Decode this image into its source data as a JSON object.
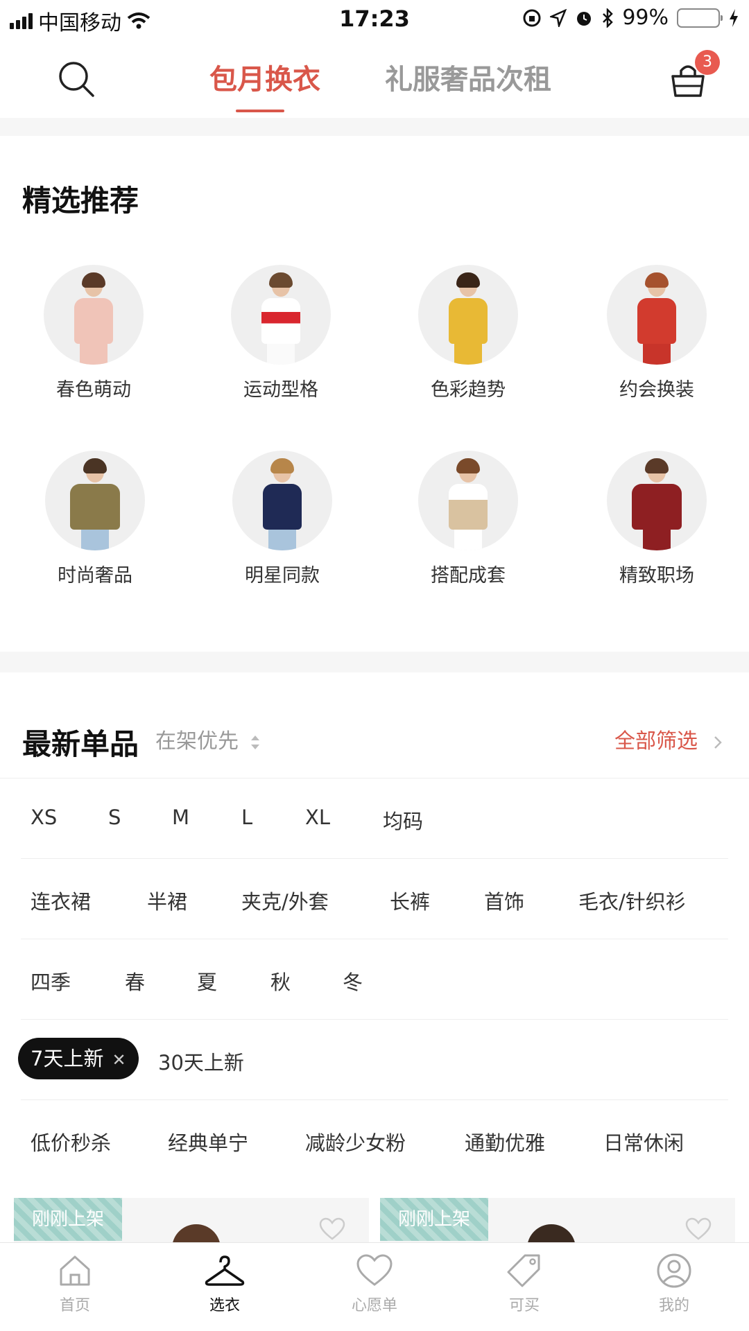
{
  "status": {
    "carrier": "中国移动",
    "time": "17:23",
    "battery": "99%"
  },
  "header": {
    "tabs": [
      {
        "label": "包月换衣"
      },
      {
        "label": "礼服奢品次租"
      }
    ],
    "cart_count": "3"
  },
  "featured": {
    "title": "精选推荐",
    "categories": [
      {
        "label": "春色萌动"
      },
      {
        "label": "运动型格"
      },
      {
        "label": "色彩趋势"
      },
      {
        "label": "约会换装"
      },
      {
        "label": "时尚奢品"
      },
      {
        "label": "明星同款"
      },
      {
        "label": "搭配成套"
      },
      {
        "label": "精致职场"
      }
    ]
  },
  "latest": {
    "title": "最新单品",
    "sort_label": "在架优先",
    "filter_all": "全部筛选",
    "sizes": [
      "XS",
      "S",
      "M",
      "L",
      "XL",
      "均码"
    ],
    "types": [
      "连衣裙",
      "半裙",
      "夹克/外套",
      "长裤",
      "首饰",
      "毛衣/针织衫"
    ],
    "seasons": [
      "四季",
      "春",
      "夏",
      "秋",
      "冬"
    ],
    "new_active": "7天上新",
    "new_other": "30天上新",
    "styles": [
      "低价秒杀",
      "经典单宁",
      "减龄少女粉",
      "通勤优雅",
      "日常休闲"
    ]
  },
  "cards": [
    {
      "tag": "刚刚上架"
    },
    {
      "tag": "刚刚上架"
    }
  ],
  "tabbar": {
    "items": [
      {
        "label": "首页"
      },
      {
        "label": "选衣"
      },
      {
        "label": "心愿单"
      },
      {
        "label": "可买"
      },
      {
        "label": "我的"
      }
    ]
  },
  "colors": {
    "accent": "#d9574a",
    "badge": "#e85a50",
    "battery": "#4cd964"
  },
  "icons": [
    "search-icon",
    "shopping-bag-icon",
    "sort-icon",
    "chevron-right-icon",
    "heart-icon",
    "home-icon",
    "hanger-icon",
    "tag-icon",
    "user-icon"
  ]
}
